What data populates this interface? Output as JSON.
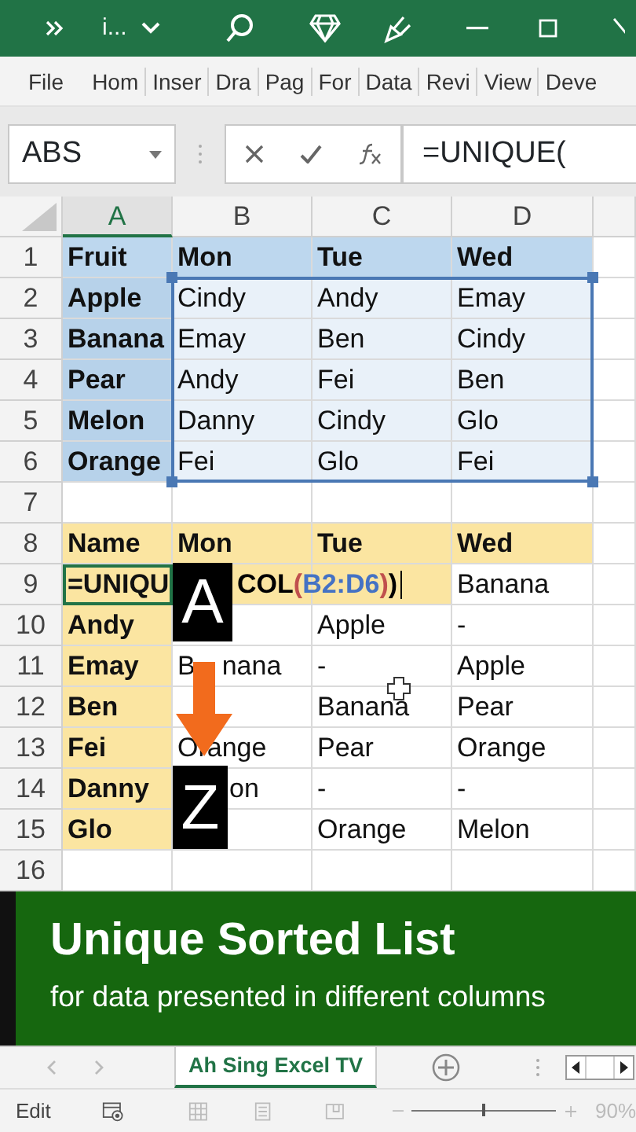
{
  "title_bar": {
    "title": "i..."
  },
  "ribbon_tabs": [
    {
      "label": "File"
    },
    {
      "label": "Hom"
    },
    {
      "label": "Inser"
    },
    {
      "label": "Dra"
    },
    {
      "label": "Pag"
    },
    {
      "label": "For"
    },
    {
      "label": "Data"
    },
    {
      "label": "Revi"
    },
    {
      "label": "View"
    },
    {
      "label": "Deve"
    }
  ],
  "formula_bar": {
    "name_box": "ABS",
    "formula": "=UNIQUE("
  },
  "columns": [
    {
      "label": "A",
      "selected": true
    },
    {
      "label": "B",
      "selected": false
    },
    {
      "label": "C",
      "selected": false
    },
    {
      "label": "D",
      "selected": false
    }
  ],
  "rows": [
    {
      "num": "1",
      "cells": [
        {
          "text": "Fruit",
          "kind": "head_blue",
          "selected": false
        },
        {
          "text": "Mon",
          "kind": "head_blue",
          "selected": false
        },
        {
          "text": "Tue",
          "kind": "head_blue",
          "selected": false
        },
        {
          "text": "Wed",
          "kind": "head_blue",
          "selected": false
        }
      ]
    },
    {
      "num": "2",
      "cells": [
        {
          "text": "Apple",
          "kind": "label_blue",
          "selected": false
        },
        {
          "text": "Cindy",
          "kind": "range",
          "selected": false
        },
        {
          "text": "Andy",
          "kind": "range",
          "selected": false
        },
        {
          "text": "Emay",
          "kind": "range",
          "selected": false
        }
      ]
    },
    {
      "num": "3",
      "cells": [
        {
          "text": "Banana",
          "kind": "label_blue",
          "selected": false
        },
        {
          "text": "Emay",
          "kind": "range",
          "selected": false
        },
        {
          "text": "Ben",
          "kind": "range",
          "selected": false
        },
        {
          "text": "Cindy",
          "kind": "range",
          "selected": false
        }
      ]
    },
    {
      "num": "4",
      "cells": [
        {
          "text": "Pear",
          "kind": "label_blue",
          "selected": false
        },
        {
          "text": "Andy",
          "kind": "range",
          "selected": false
        },
        {
          "text": "Fei",
          "kind": "range",
          "selected": false
        },
        {
          "text": "Ben",
          "kind": "range",
          "selected": false
        }
      ]
    },
    {
      "num": "5",
      "cells": [
        {
          "text": "Melon",
          "kind": "label_blue",
          "selected": false
        },
        {
          "text": "Danny",
          "kind": "range",
          "selected": false
        },
        {
          "text": "Cindy",
          "kind": "range",
          "selected": false
        },
        {
          "text": "Glo",
          "kind": "range",
          "selected": false
        }
      ]
    },
    {
      "num": "6",
      "cells": [
        {
          "text": "Orange",
          "kind": "label_blue",
          "selected": false
        },
        {
          "text": "Fei",
          "kind": "range",
          "selected": false
        },
        {
          "text": "Glo",
          "kind": "range",
          "selected": false
        },
        {
          "text": "Fei",
          "kind": "range",
          "selected": false
        }
      ]
    },
    {
      "num": "7",
      "cells": [
        {
          "kind": "plain",
          "selected": false
        },
        {
          "kind": "plain",
          "selected": false
        },
        {
          "kind": "plain",
          "selected": false
        },
        {
          "kind": "plain",
          "selected": false
        }
      ]
    },
    {
      "num": "8",
      "cells": [
        {
          "text": "Name",
          "kind": "head_yellow",
          "selected": false
        },
        {
          "text": "Mon",
          "kind": "head_yellow",
          "selected": false
        },
        {
          "text": "Tue",
          "kind": "head_yellow",
          "selected": false
        },
        {
          "text": "Wed",
          "kind": "head_yellow",
          "selected": false
        }
      ]
    },
    {
      "num": "9",
      "cells": [
        {
          "text": "=UNIQU",
          "kind": "head_yellow",
          "selected": true
        },
        {
          "kind": "head_yellow",
          "selected": false,
          "tokens": [
            {
              "text": "COL",
              "color": "#000000"
            },
            {
              "text": "(",
              "color": "#c0504d"
            },
            {
              "text": "B2:D6",
              "color": "#4472c4"
            },
            {
              "text": ")",
              "color": "#c0504d"
            },
            {
              "text": ")",
              "color": "#000000"
            }
          ]
        },
        {
          "kind": "head_yellow",
          "selected": false
        },
        {
          "text": "Banana",
          "kind": "plain",
          "selected": false
        }
      ]
    },
    {
      "num": "10",
      "cells": [
        {
          "text": "Andy",
          "kind": "label_yellow",
          "selected": false
        },
        {
          "kind": "plain",
          "selected": false
        },
        {
          "text": "Apple",
          "kind": "plain",
          "selected": false
        },
        {
          "text": "-",
          "kind": "plain",
          "selected": false
        }
      ]
    },
    {
      "num": "11",
      "cells": [
        {
          "text": "Emay",
          "kind": "label_yellow",
          "selected": false
        },
        {
          "parts": [
            "B",
            "nana"
          ],
          "kind": "split",
          "selected": false
        },
        {
          "text": "-",
          "kind": "plain",
          "selected": false
        },
        {
          "text": "Apple",
          "kind": "plain",
          "selected": false
        }
      ]
    },
    {
      "num": "12",
      "cells": [
        {
          "text": "Ben",
          "kind": "label_yellow",
          "selected": false
        },
        {
          "kind": "plain",
          "selected": false
        },
        {
          "text": "Banana",
          "kind": "plain",
          "selected": false
        },
        {
          "text": "Pear",
          "kind": "plain",
          "selected": false
        }
      ]
    },
    {
      "num": "13",
      "cells": [
        {
          "text": "Fei",
          "kind": "label_yellow",
          "selected": false
        },
        {
          "text": "Orange",
          "kind": "plain",
          "selected": false
        },
        {
          "text": "Pear",
          "kind": "plain",
          "selected": false
        },
        {
          "text": "Orange",
          "kind": "plain",
          "selected": false
        }
      ]
    },
    {
      "num": "14",
      "cells": [
        {
          "text": "Danny",
          "kind": "label_yellow",
          "selected": false
        },
        {
          "text": "on",
          "kind": "indented",
          "selected": false
        },
        {
          "text": "-",
          "kind": "plain",
          "selected": false
        },
        {
          "text": "-",
          "kind": "plain",
          "selected": false
        }
      ]
    },
    {
      "num": "15",
      "cells": [
        {
          "text": "Glo",
          "kind": "label_yellow",
          "selected": false
        },
        {
          "kind": "plain",
          "selected": false
        },
        {
          "text": "Orange",
          "kind": "plain",
          "selected": false
        },
        {
          "text": "Melon",
          "kind": "plain",
          "selected": false
        }
      ]
    },
    {
      "num": "16",
      "cells": [
        {
          "kind": "plain",
          "selected": false
        },
        {
          "kind": "plain",
          "selected": false
        },
        {
          "kind": "plain",
          "selected": false
        },
        {
          "kind": "plain",
          "selected": false
        }
      ]
    }
  ],
  "overlays": [
    {
      "kind": "letter_badge",
      "text": "A"
    },
    {
      "kind": "arrow"
    },
    {
      "kind": "letter_badge",
      "text": "Z"
    }
  ],
  "banner": {
    "title": "Unique Sorted List",
    "subtitle": "for data presented in different columns"
  },
  "sheet_tabs": [
    {
      "label": "Ah Sing Excel TV",
      "selected": true
    }
  ],
  "status_bar": {
    "mode": "Edit",
    "zoom": "90%",
    "zoom_level": {
      "level": 0.5
    }
  }
}
